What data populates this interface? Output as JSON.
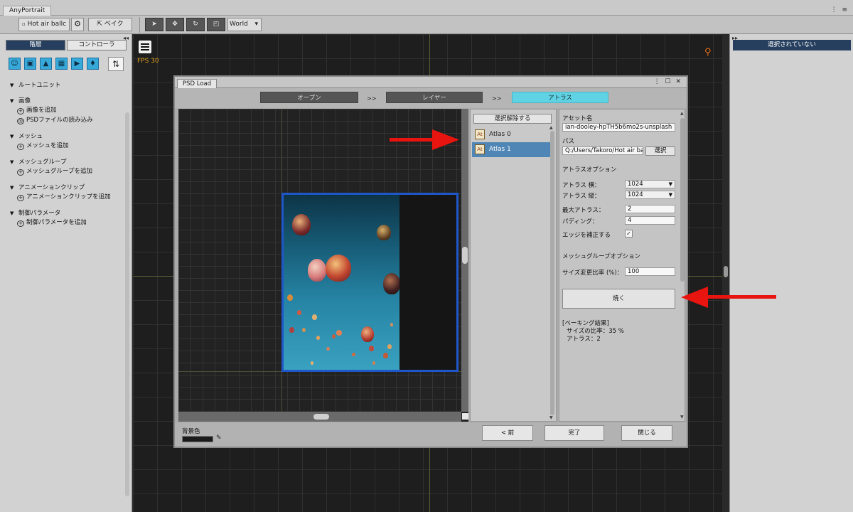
{
  "app": {
    "title": "AnyPortrait",
    "menu_glyph": "⋮ ≡"
  },
  "toolbar": {
    "image_name": "Hot air ballc",
    "settings_icon": "gear-icon",
    "bake_label": "ベイク",
    "tools": [
      "select-arrow-icon",
      "move-icon",
      "rotate-icon",
      "scale-icon"
    ],
    "space_value": "World",
    "space_caret": "▾"
  },
  "left_panel": {
    "collapse_glyph": "◂◂",
    "tabs": [
      "階層",
      "コントローラ"
    ],
    "sort_glyph": "⇅",
    "tree": [
      {
        "label": "ルートユニット",
        "children": []
      },
      {
        "label": "画像",
        "children": [
          "画像を追加",
          "PSDファイルの読み込み"
        ]
      },
      {
        "label": "メッシュ",
        "children": [
          "メッシュを追加"
        ]
      },
      {
        "label": "メッシュグループ",
        "children": [
          "メッシュグループを追加"
        ]
      },
      {
        "label": "アニメーションクリップ",
        "children": [
          "アニメーションクリップを追加"
        ]
      },
      {
        "label": "制御パラメータ",
        "children": [
          "制御パラメータを追加"
        ]
      }
    ]
  },
  "canvas": {
    "fps_label": "FPS 30"
  },
  "right_panel": {
    "collapse_glyph": "▸▸",
    "header": "選択されていない"
  },
  "dialog": {
    "title": "PSD Load",
    "controls": "⋮ ☐ ✕",
    "steps": [
      "オープン",
      "レイヤー",
      "アトラス"
    ],
    "step_arrow": ">>",
    "active_step": 2,
    "deselect_label": "選択解除する",
    "atlas_items": [
      {
        "label": "Atlas 0",
        "selected": false
      },
      {
        "label": "Atlas 1",
        "selected": true
      }
    ],
    "props": {
      "asset_name_label": "アセット名",
      "asset_name_value": "ian-dooley-hpTH5b6mo2s-unsplash",
      "path_label": "パス",
      "path_value": "Q:/Users/Takoro/Hot air bal",
      "select_label": "選択",
      "atlas_options_label": "アトラスオプション",
      "atlas_width_label": "アトラス 横：",
      "atlas_width_value": "1024",
      "atlas_height_label": "アトラス 縦：",
      "atlas_height_value": "1024",
      "max_atlas_label": "最大アトラス：",
      "max_atlas_value": "2",
      "padding_label": "パディング：",
      "padding_value": "4",
      "edge_fix_label": "エッジを補正する",
      "edge_fix_checked": "✓",
      "mesh_group_options_label": "メッシュグループオプション",
      "resize_ratio_label": "サイズ変更比率 (%)：",
      "resize_ratio_value": "100",
      "bake_button": "焼く",
      "result_title": "[ベーキング結果]",
      "result_size": "サイズの比率：35 %",
      "result_atlas": "アトラス：2"
    },
    "footer": {
      "bg_color_label": "背景色",
      "prev_button": "< 前",
      "finish_button": "完了",
      "close_button": "閉じる"
    }
  },
  "colors": {
    "active_tab": "#263f5e",
    "active_step": "#5fd2e4",
    "selected_item": "#4f86b5",
    "arrow_red": "#e8140f",
    "atlas_border": "#1f57c9",
    "fps_orange": "#e1a01f"
  }
}
